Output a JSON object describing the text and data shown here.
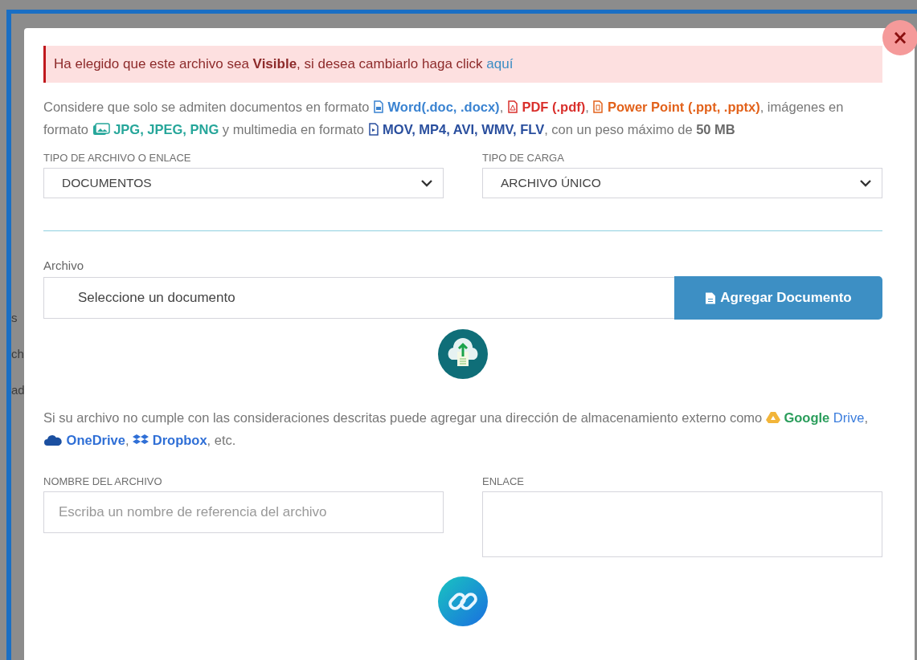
{
  "background_texts": [
    "s",
    "ch",
    "ad"
  ],
  "dialog": {
    "close": "×",
    "notice": {
      "text": "Ha elegido que este archivo sea **Visible**, si desea cambiarlo haga click ",
      "link": "aquí"
    },
    "formats_note": [
      {
        "kind": "plain",
        "text": "Considere que solo se admiten documentos en formato "
      },
      {
        "kind": "doc",
        "text": "Word(.doc, .docx)",
        "color": "#3a83d1"
      },
      {
        "kind": "plain",
        "text": ", "
      },
      {
        "kind": "pdf",
        "text": "PDF (.pdf)",
        "color": "#d9302c"
      },
      {
        "kind": "plain",
        "text": ", "
      },
      {
        "kind": "slides",
        "text": "Power Point (.ppt, .pptx)",
        "color": "#e2621b"
      },
      {
        "kind": "plain",
        "text": ", imágenes en formato "
      },
      {
        "kind": "image",
        "text": " JPG, JPEG, PNG",
        "color": "#26a69a"
      },
      {
        "kind": "plain",
        "text": " y multimedia en formato "
      },
      {
        "kind": "video",
        "text": " MOV, MP4, AVI, WMV, FLV",
        "color": "#2a4f9e"
      },
      {
        "kind": "plain",
        "text": ", con un peso máximo de **50 MB**"
      }
    ],
    "selects": [
      {
        "label": "TIPO DE ARCHIVO O ENLACE",
        "value": "DOCUMENTOS"
      },
      {
        "label": "TIPO DE CARGA",
        "value": "ARCHIVO ÚNICO"
      }
    ],
    "file": {
      "label": "Archivo",
      "placeholder": "Seleccione un documento",
      "button": "Agregar Documento"
    },
    "external_note": [
      {
        "kind": "plain",
        "text": "Si su archivo no cumple con las consideraciones descritas puede agregar una dirección de almacenamiento externo como "
      },
      {
        "kind": "drive",
        "text": "Google",
        "color": "#2a9d5b"
      },
      {
        "kind": "plain",
        "text": " Drive",
        "color": "#3b7ddd"
      },
      {
        "kind": "plain",
        "text": ", "
      },
      {
        "kind": "cloud",
        "text": "OneDrive",
        "color": "#2f6fd6"
      },
      {
        "kind": "plain",
        "text": ", "
      },
      {
        "kind": "dropbox",
        "text": "Dropbox",
        "color": "#2f6fd6"
      },
      {
        "kind": "plain",
        "text": ", etc."
      }
    ],
    "name_field": {
      "label": "NOMBRE DEL ARCHIVO",
      "placeholder": "Escriba un nombre de referencia del archivo"
    },
    "link_field": {
      "label": "ENLACE"
    }
  }
}
